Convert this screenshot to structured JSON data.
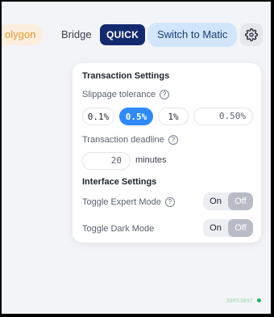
{
  "topbar": {
    "network_label": "olygon",
    "bridge_label": "Bridge",
    "quick_label": "QUICK",
    "switch_label": "Switch to Matic",
    "settings_icon": "gear-icon"
  },
  "transaction": {
    "title": "Transaction Settings",
    "slippage_label": "Slippage tolerance",
    "slippage_options": [
      "0.1%",
      "0.5%",
      "1%"
    ],
    "slippage_selected": "0.5%",
    "slippage_custom_value": "0.50",
    "slippage_custom_suffix": "%",
    "deadline_label": "Transaction deadline",
    "deadline_value": "20",
    "deadline_unit": "minutes"
  },
  "interface": {
    "title": "Interface Settings",
    "expert_label": "Toggle Expert Mode",
    "dark_label": "Toggle Dark Mode",
    "on_label": "On",
    "off_label": "Off"
  },
  "footer": {
    "block_number": "30653897"
  },
  "colors": {
    "accent": "#2f8af5",
    "quick_bg": "#142a6e",
    "matic_bg": "#d1e6fb",
    "network_text": "#e9992d",
    "status_green": "#27ae60"
  }
}
